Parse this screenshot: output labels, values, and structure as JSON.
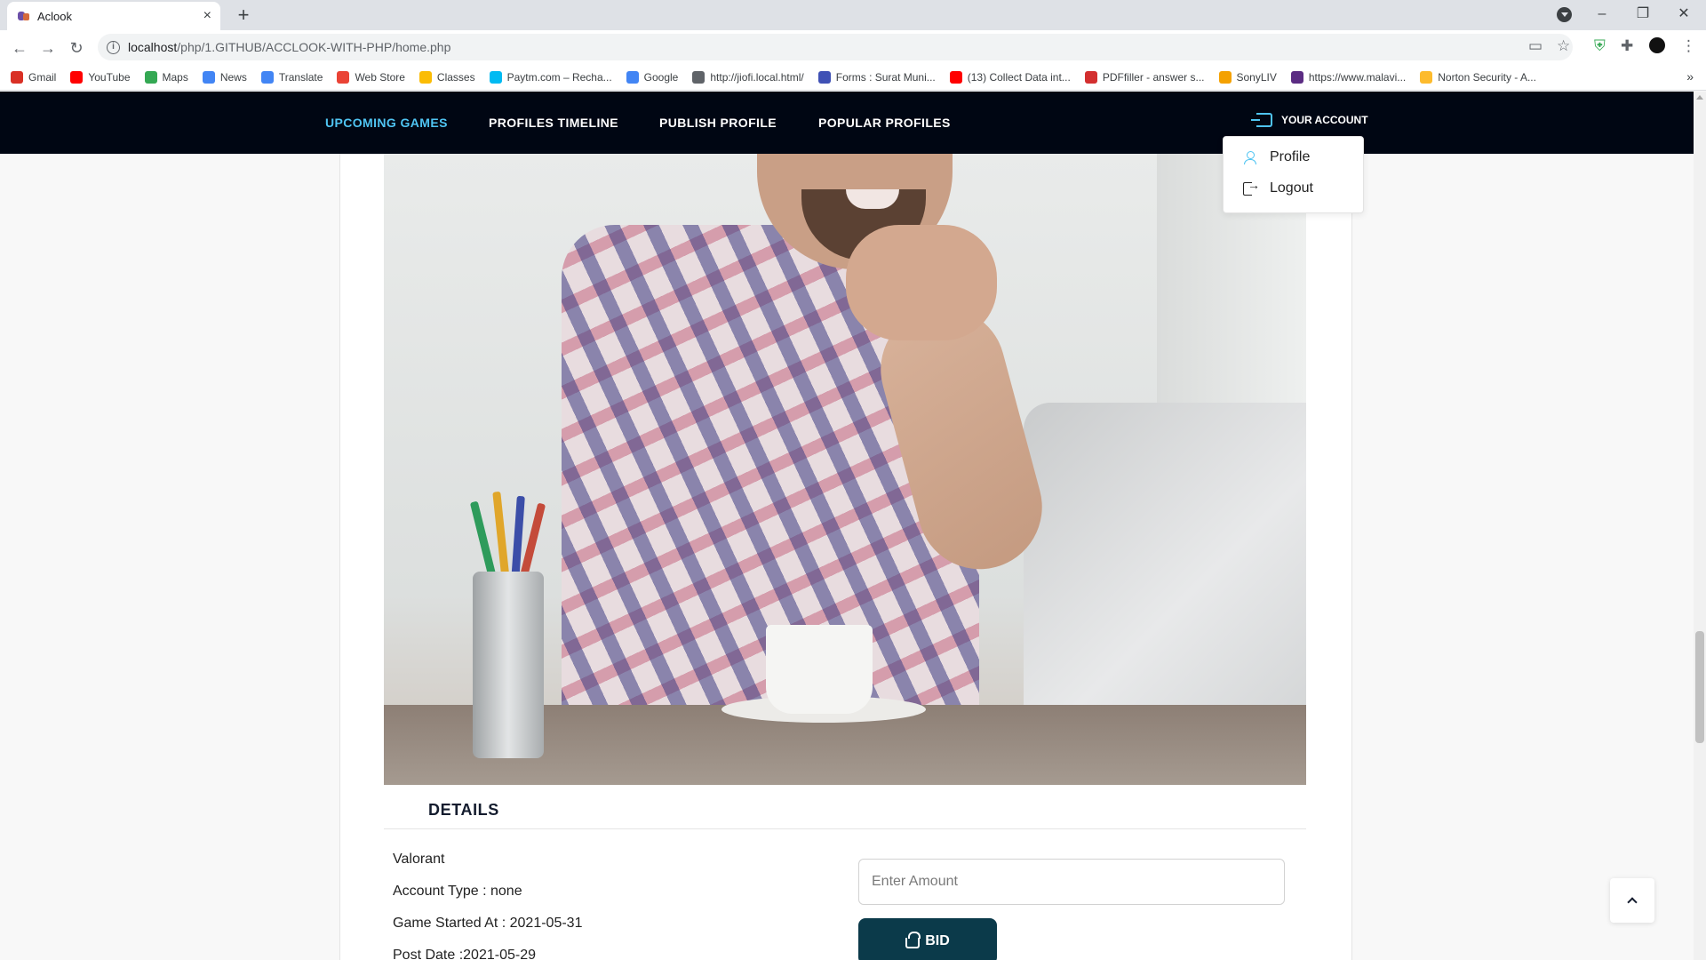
{
  "browser": {
    "tab_title": "Aclook",
    "tab_close": "×",
    "new_tab": "+",
    "url_host": "localhost",
    "url_path": "/php/1.GITHUB/ACCLOOK-WITH-PHP/home.php",
    "window_controls": [
      "–",
      "❐",
      "✕"
    ],
    "bookmarks": [
      {
        "label": "Gmail",
        "color": "#d93025"
      },
      {
        "label": "YouTube",
        "color": "#ff0000"
      },
      {
        "label": "Maps",
        "color": "#34a853"
      },
      {
        "label": "News",
        "color": "#4285f4"
      },
      {
        "label": "Translate",
        "color": "#4285f4"
      },
      {
        "label": "Web Store",
        "color": "#ea4335"
      },
      {
        "label": "Classes",
        "color": "#fbbc04"
      },
      {
        "label": "Paytm.com – Recha...",
        "color": "#00baf2"
      },
      {
        "label": "Google",
        "color": "#4285f4"
      },
      {
        "label": "http://jiofi.local.html/",
        "color": "#5f6368"
      },
      {
        "label": "Forms : Surat Muni...",
        "color": "#3f51b5"
      },
      {
        "label": "(13) Collect Data int...",
        "color": "#ff0000"
      },
      {
        "label": "PDFfiller - answer s...",
        "color": "#d32f2f"
      },
      {
        "label": "SonyLIV",
        "color": "#f4a100"
      },
      {
        "label": "https://www.malavi...",
        "color": "#5b2c83"
      },
      {
        "label": "Norton Security - A...",
        "color": "#fdbb2d"
      }
    ],
    "bookmarks_more": "»"
  },
  "nav": {
    "items": [
      "UPCOMING GAMES",
      "PROFILES TIMELINE",
      "PUBLISH PROFILE",
      "POPULAR PROFILES"
    ],
    "active_index": 0,
    "account_label": "YOUR ACCOUNT"
  },
  "account_menu": {
    "profile": "Profile",
    "logout": "Logout"
  },
  "details": {
    "heading": "DETAILS",
    "game": "Valorant",
    "account_type": "Account Type : none",
    "game_started": "Game Started At : 2021-05-31",
    "post_date": "Post Date :2021-05-29"
  },
  "bid": {
    "placeholder": "Enter Amount",
    "button_label": "BID"
  },
  "colors": {
    "nav_bg": "#000613",
    "accent": "#4fc4f2",
    "bid_button": "#0b3a4a"
  }
}
